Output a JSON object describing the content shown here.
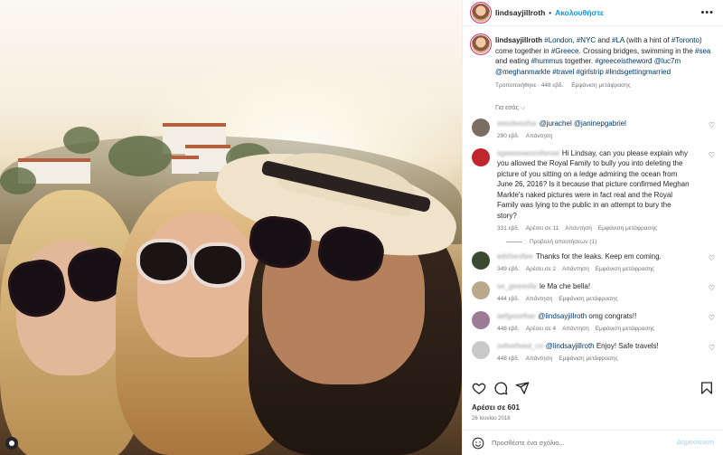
{
  "post": {
    "username": "lindsayjillroth",
    "follow_label": "Ακολουθήστε",
    "more_icon": "more-horizontal-icon"
  },
  "caption": {
    "username": "lindsayjillroth",
    "parts": [
      {
        "t": "#London",
        "tag": true
      },
      {
        "t": ", ",
        "tag": false
      },
      {
        "t": "#NYC",
        "tag": true
      },
      {
        "t": " and ",
        "tag": false
      },
      {
        "t": "#LA",
        "tag": true
      },
      {
        "t": " (with a hint of ",
        "tag": false
      },
      {
        "t": "#Toronto",
        "tag": true
      },
      {
        "t": ") come together in ",
        "tag": false
      },
      {
        "t": "#Greece",
        "tag": true
      },
      {
        "t": ". Crossing bridges, swimming in the ",
        "tag": false
      },
      {
        "t": "#sea",
        "tag": true
      },
      {
        "t": " and eating ",
        "tag": false
      },
      {
        "t": "#hummus",
        "tag": true
      },
      {
        "t": " together. ",
        "tag": false
      },
      {
        "t": "#greeceistheword",
        "tag": true
      },
      {
        "t": " ",
        "tag": false
      },
      {
        "t": "@luc7m",
        "tag": true
      },
      {
        "t": " ",
        "tag": false
      },
      {
        "t": "@meghanmarkle",
        "tag": true
      },
      {
        "t": " ",
        "tag": false
      },
      {
        "t": "#travel",
        "tag": true
      },
      {
        "t": " ",
        "tag": false
      },
      {
        "t": "#girlstrip",
        "tag": true
      },
      {
        "t": " ",
        "tag": false
      },
      {
        "t": "#lindsgettingmarried",
        "tag": true
      }
    ],
    "edited": "Τροποποιήθηκε",
    "time": "448 εβδ.",
    "translate": "Εμφάνιση μετάφρασης"
  },
  "sort_label": "Για εσάς",
  "comments": [
    {
      "name": "awsdwesfse",
      "text": "",
      "mentions": [
        "@jurachel",
        "@janinepgabriel"
      ],
      "time": "290 εβδ.",
      "likes": "",
      "reply": "Απάντηση",
      "translate": "",
      "avatar_color": "#7a6d63"
    },
    {
      "name": "sgewsewesrsfwrwe",
      "text": "Hi Lindsay, can you please explain why you allowed the Royal Family to bully you into deleting the picture of you sitting on a ledge admiring the ocean from June 26, 2016? Is it because that picture confirmed Meghan Markle's naked pictures were in fact real and the Royal Family was lying to the public in an attempt to bury the story?",
      "mentions": [],
      "time": "331 εβδ.",
      "likes": "Αρέσει σε 11",
      "reply": "Απάντηση",
      "translate": "Εμφάνιση μετάφρασης",
      "avatar_color": "#c0262e"
    },
    {
      "name": "edsfsesfwe",
      "text": "Thanks for the leaks. Keep em coming.",
      "mentions": [],
      "time": "349 εβδ.",
      "likes": "Αρέσει σε 2",
      "reply": "Απάντηση",
      "translate": "Εμφάνιση μετάφρασης",
      "avatar_color": "#3a4a32"
    },
    {
      "name": "se_gewesfw",
      "text": "le Ma che bella!",
      "mentions": [],
      "time": "444 εβδ.",
      "likes": "",
      "reply": "Απάντηση",
      "translate": "Εμφάνιση μετάφρασης",
      "avatar_color": "#b9a88a"
    },
    {
      "name": "aefgwsefwe",
      "text": "omg congrats!!",
      "mentions": [
        "@lindsayjillroth"
      ],
      "time": "448 εβδ.",
      "likes": "Αρέσει σε 4",
      "reply": "Απάντηση",
      "translate": "Εμφάνιση μετάφρασης",
      "avatar_color": "#9b7b95"
    },
    {
      "name": "sefwefwed_co",
      "text": "Enjoy! Safe travels!",
      "mentions": [
        "@lindsayjillroth"
      ],
      "time": "448 εβδ.",
      "likes": "",
      "reply": "Απάντηση",
      "translate": "Εμφάνιση μετάφρασης",
      "avatar_color": "#c9c9c9"
    }
  ],
  "view_replies": "Προβολή απαντήσεων (1)",
  "like_count": "Αρέσει σε 601",
  "date": "26 Ιουνίου 2016",
  "add_comment": {
    "placeholder": "Προσθέστε ένα σχόλιο...",
    "post_label": "Δημοσίευση"
  }
}
